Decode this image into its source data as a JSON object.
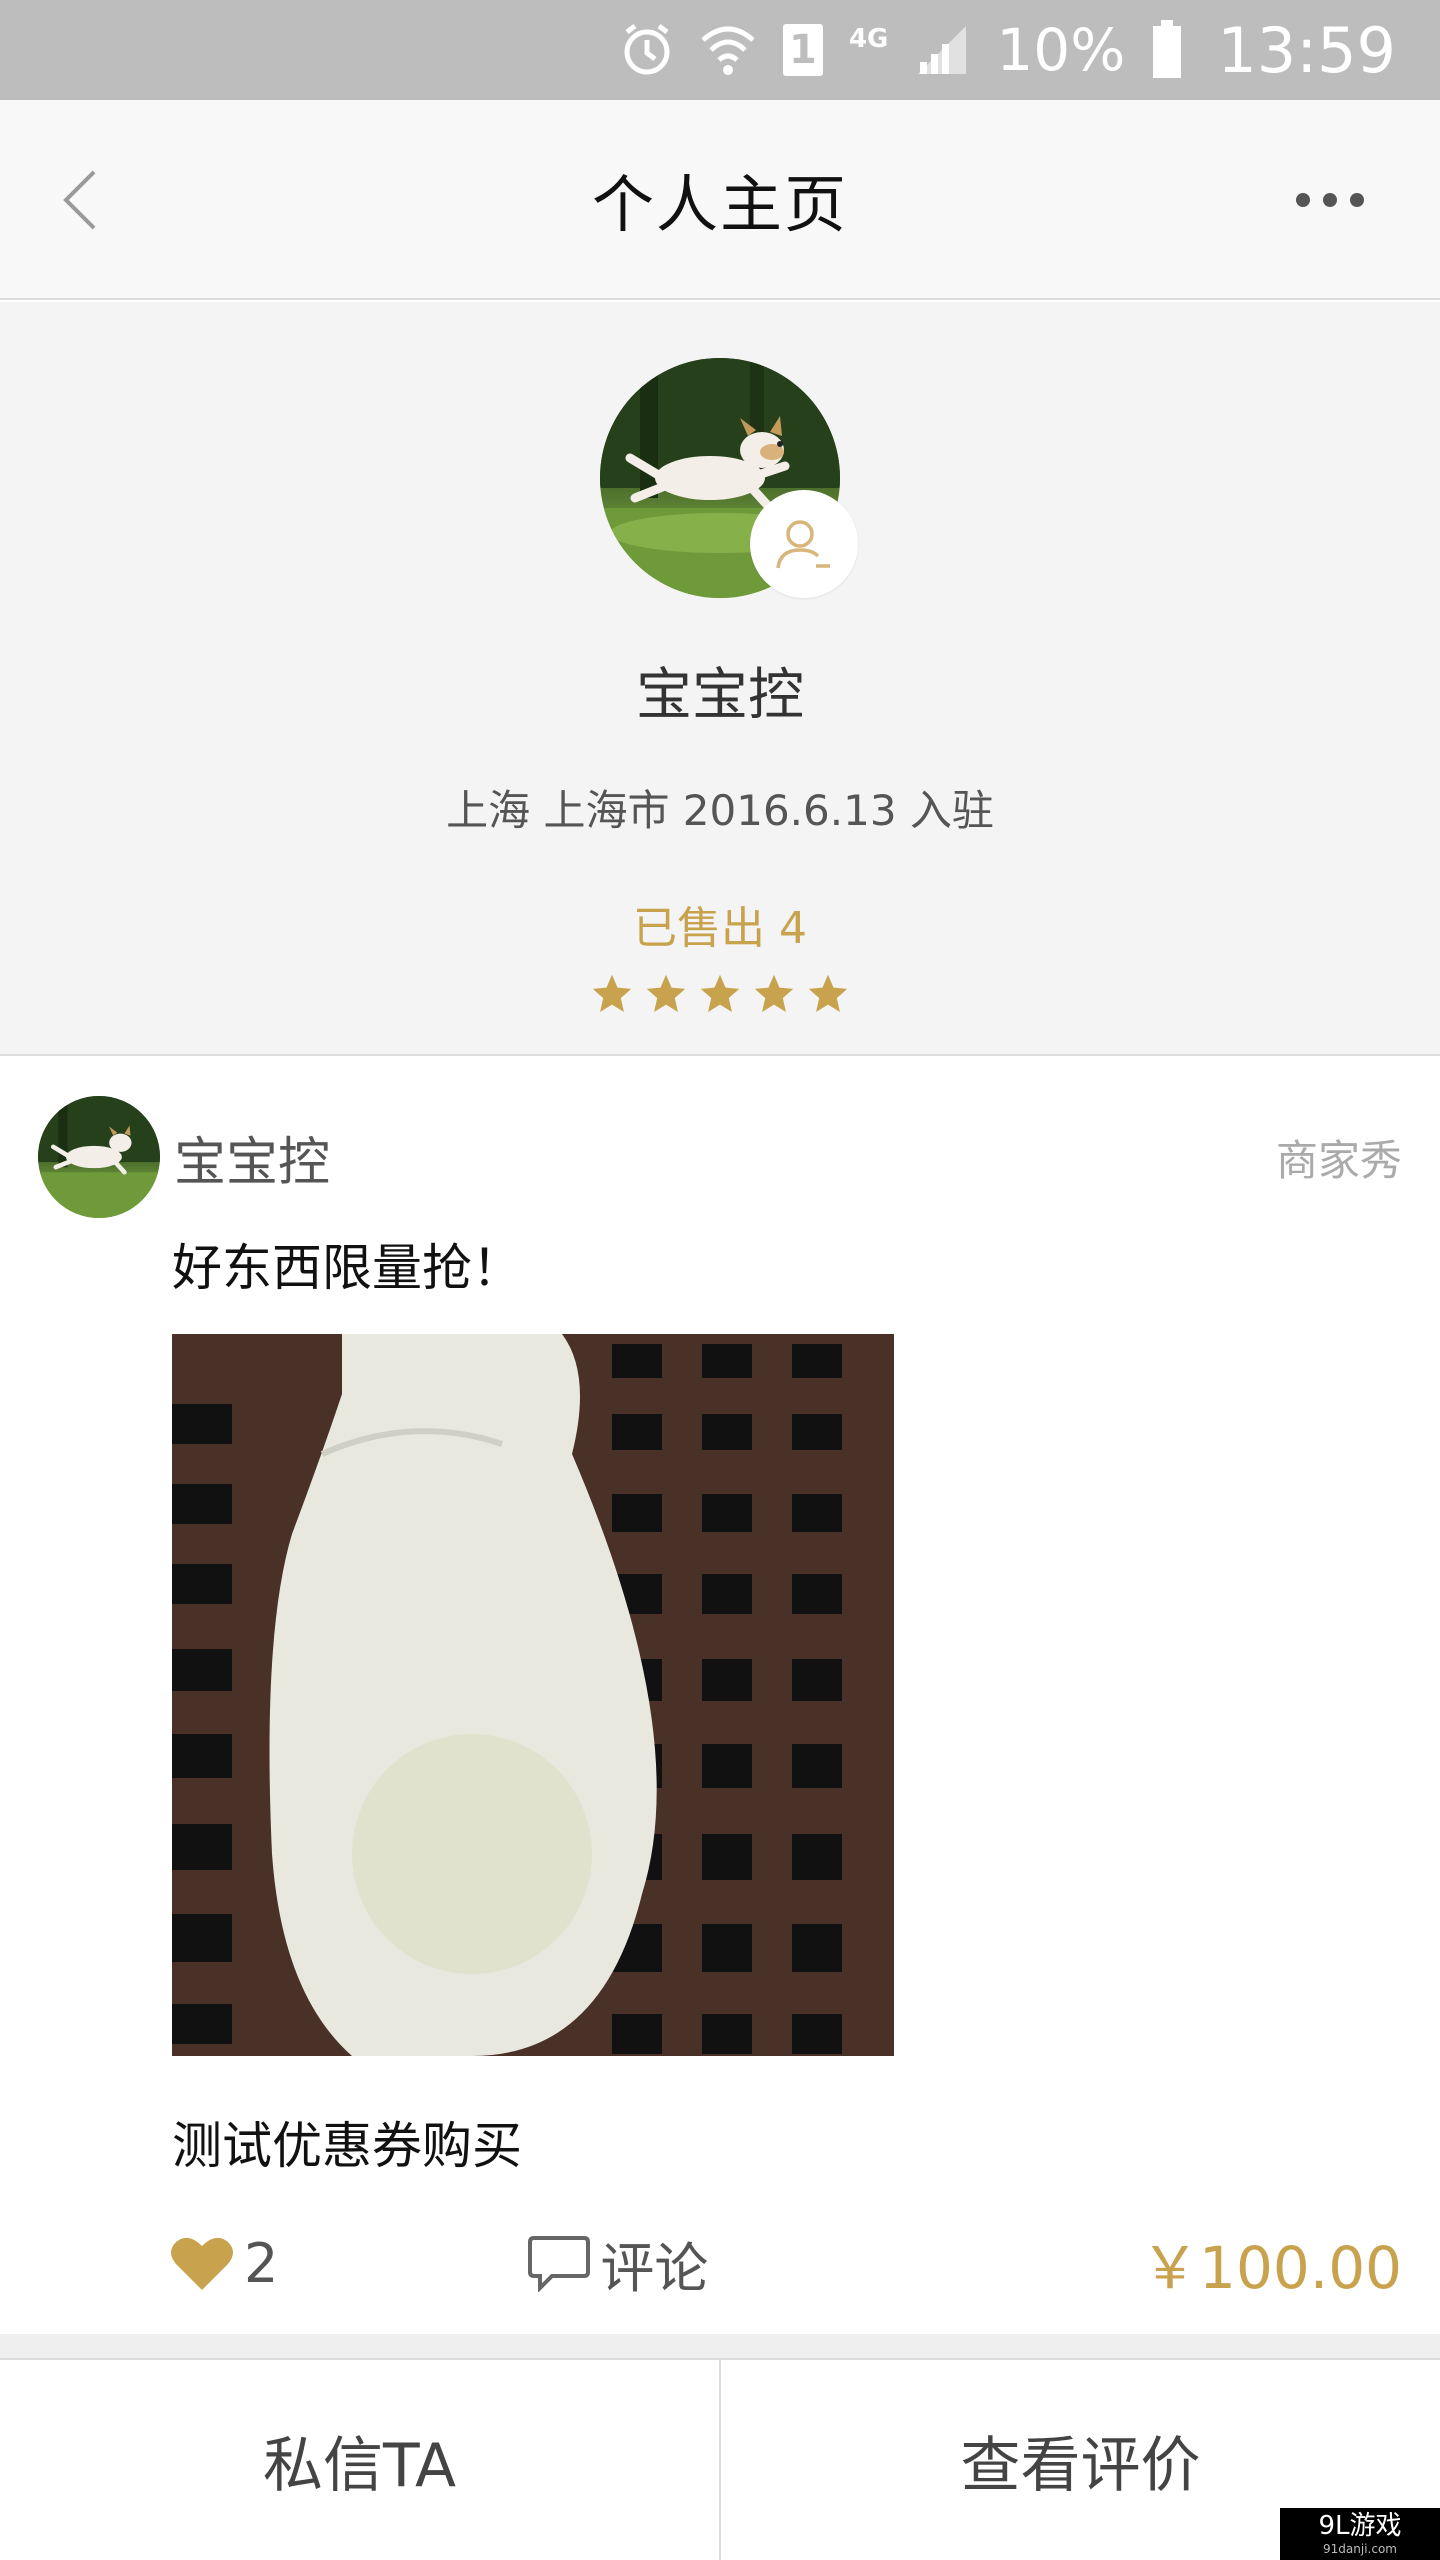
{
  "status_bar": {
    "sim": "1",
    "network": "4G",
    "battery": "10%",
    "time": "13:59"
  },
  "nav": {
    "title": "个人主页"
  },
  "profile": {
    "name": "宝宝控",
    "meta": "上海 上海市  2016.6.13 入驻",
    "sold": "已售出 4",
    "rating_stars": 5
  },
  "post": {
    "user": "宝宝控",
    "tag": "商家秀",
    "text": "好东西限量抢！",
    "title": "测试优惠券购买",
    "likes": "2",
    "comment_label": "评论",
    "price": "￥100.00"
  },
  "bottom": {
    "message_label": "私信TA",
    "reviews_label": "查看评价"
  },
  "watermark": {
    "text": "9L游戏",
    "url": "91danji.com"
  },
  "colors": {
    "accent": "#c9a24d",
    "statusbar": "#bdbdbd"
  }
}
